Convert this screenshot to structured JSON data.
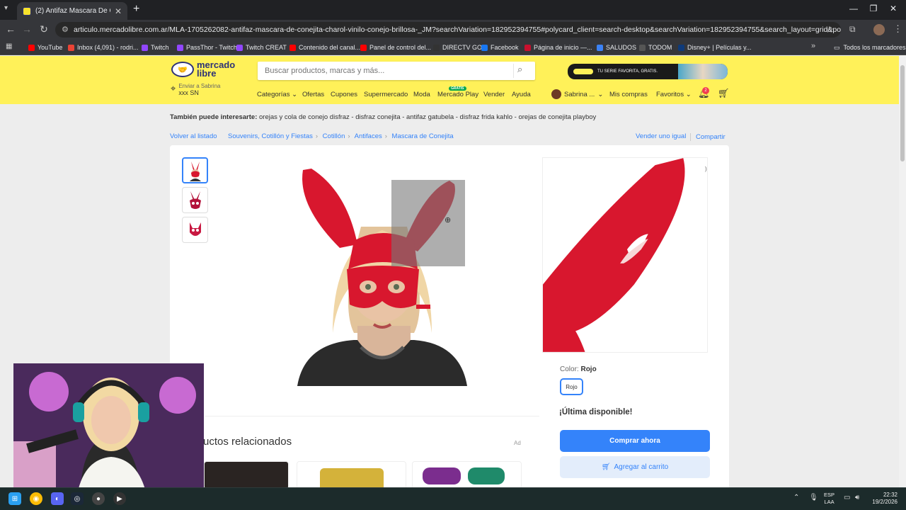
{
  "browser": {
    "tab_title": "(2) Antifaz Mascara De Conejita",
    "url": "articulo.mercadolibre.com.ar/MLA-1705262082-antifaz-mascara-de-conejita-charol-vinilo-conejo-brillosa-_JM?searchVariation=182952394755#polycard_client=search-desktop&searchVariation=182952394755&search_layout=grid&position=29&type=ite...",
    "bookmarks": [
      {
        "label": "YouTube",
        "color": "#ff0000"
      },
      {
        "label": "Inbox (4,091) - rodri...",
        "color": "#ea4335"
      },
      {
        "label": "Twitch",
        "color": "#9146ff"
      },
      {
        "label": "PassThor - Twitch",
        "color": "#9146ff"
      },
      {
        "label": "Twitch CREAT",
        "color": "#9146ff"
      },
      {
        "label": "Contenido del canal...",
        "color": "#ff0000"
      },
      {
        "label": "Panel de control del...",
        "color": "#ff0000"
      },
      {
        "label": "DIRECTV GO",
        "color": "#333333"
      },
      {
        "label": "Facebook",
        "color": "#1877f2"
      },
      {
        "label": "Página de inicio —...",
        "color": "#c8102e"
      },
      {
        "label": "SALUDOS",
        "color": "#3b82f6"
      },
      {
        "label": "TODOM",
        "color": "#555555"
      },
      {
        "label": "Disney+ | Películas y...",
        "color": "#0e3a7a"
      }
    ],
    "all_bookmarks": "Todos los marcadores"
  },
  "header": {
    "logo_line1": "mercado",
    "logo_line2": "libre",
    "search_placeholder": "Buscar productos, marcas y más...",
    "promo_text": "TU SERIE FAVORITA, GRATIS.",
    "location_line1": "Enviar a Sabrina",
    "location_line2": "xxx SN",
    "nav": [
      "Categorías",
      "Ofertas",
      "Cupones",
      "Supermercado",
      "Moda",
      "Mercado Play",
      "Vender",
      "Ayuda"
    ],
    "play_badge": "GRATIS",
    "user_name": "Sabrina ...",
    "my_purchases": "Mis compras",
    "favorites": "Favoritos",
    "notifications_count": "2"
  },
  "content": {
    "also_like_label": "También puede interesarte:",
    "also_like_items": "orejas y cola de conejo disfraz - disfraz conejita - antifaz gatubela - disfraz frida kahlo - orejas de conejita playboy",
    "back": "Volver al listado",
    "breadcrumbs": [
      "Souvenirs, Cotillón y Fiestas",
      "Cotillón",
      "Antifaces",
      "Mascara de Conejita"
    ],
    "sell_same": "Vender uno igual",
    "share": "Compartir",
    "color_label": "Color:",
    "color_value": "Rojo",
    "color_option": "Rojo",
    "stock_text": "¡Última disponible!",
    "buy_now": "Comprar ahora",
    "add_to_cart": "Agregar al carrito",
    "related_title": "uctos relacionados",
    "ad_label": "Ad"
  },
  "system": {
    "lang_line1": "ESP",
    "lang_line2": "LAA",
    "time": "22:32",
    "date": "19/2/2026"
  },
  "colors": {
    "ml_yellow": "#fff159",
    "ml_blue": "#3483fa",
    "mask_red": "#d8172e"
  }
}
